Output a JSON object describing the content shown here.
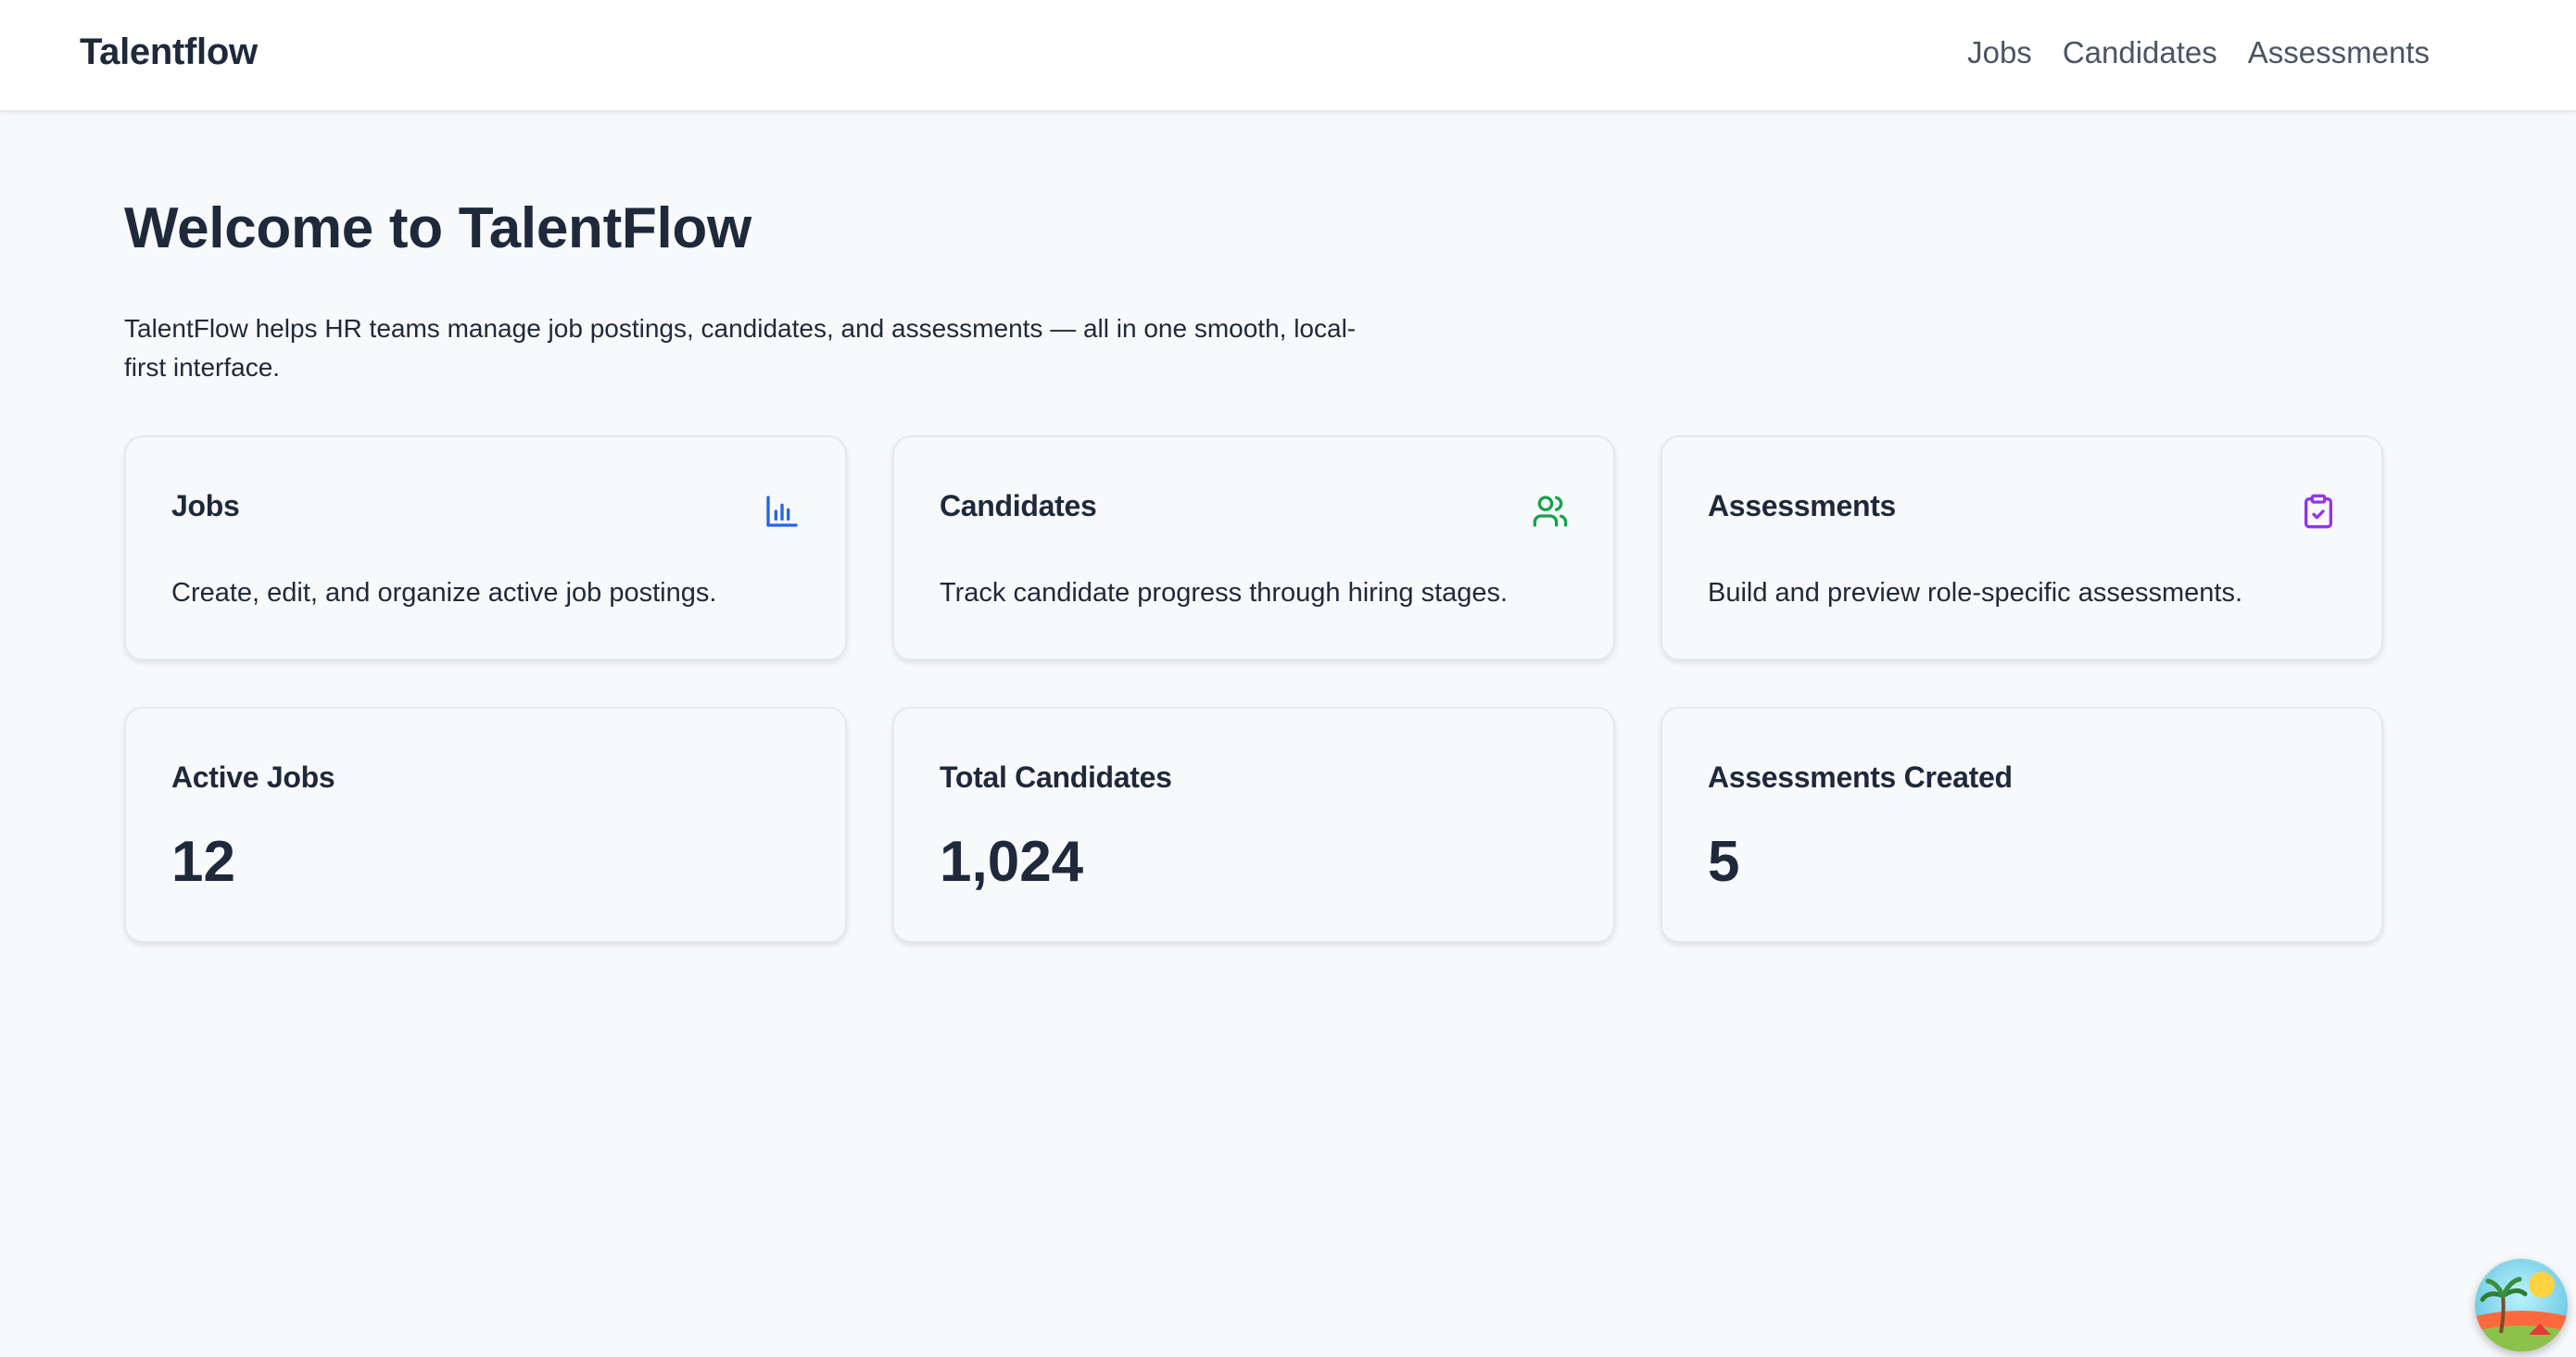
{
  "navbar": {
    "brand": "Talentflow",
    "links": [
      "Jobs",
      "Candidates",
      "Assessments"
    ]
  },
  "hero": {
    "title": "Welcome to TalentFlow",
    "description": "TalentFlow helps HR teams manage job postings, candidates, and assessments — all in one smooth, local-first interface."
  },
  "feature_cards": [
    {
      "title": "Jobs",
      "description": "Create, edit, and organize active job postings.",
      "icon": "bar-chart-icon",
      "icon_color": "#2563eb"
    },
    {
      "title": "Candidates",
      "description": "Track candidate progress through hiring stages.",
      "icon": "users-icon",
      "icon_color": "#16a34a"
    },
    {
      "title": "Assessments",
      "description": "Build and preview role-specific assessments.",
      "icon": "clipboard-check-icon",
      "icon_color": "#9333ea"
    }
  ],
  "stats": [
    {
      "label": "Active Jobs",
      "value": "12"
    },
    {
      "label": "Total Candidates",
      "value": "1,024"
    },
    {
      "label": "Assessments Created",
      "value": "5"
    }
  ],
  "colors": {
    "background": "#f8f9fb",
    "text": "#1e293b",
    "nav_text": "#4b5563"
  }
}
